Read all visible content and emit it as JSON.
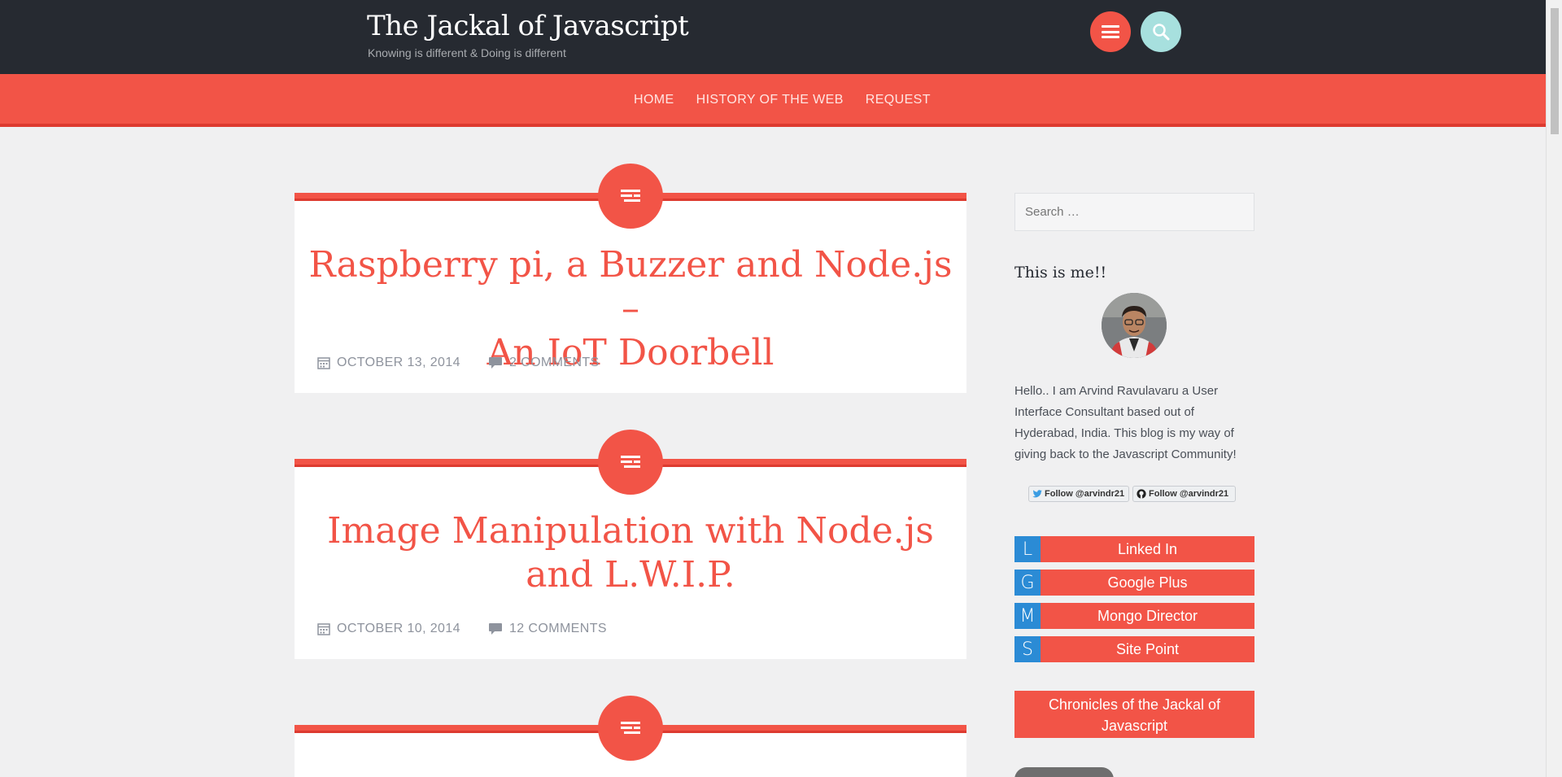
{
  "site": {
    "title": "The Jackal of Javascript",
    "description": "Knowing is different & Doing is different"
  },
  "nav": {
    "items": [
      "HOME",
      "HISTORY OF THE WEB",
      "REQUEST"
    ]
  },
  "posts": [
    {
      "title_line1": "Raspberry pi, a Buzzer and Node.js –",
      "title_line2": "An IoT Doorbell",
      "date": "OCTOBER 13, 2014",
      "comments": "2 COMMENTS"
    },
    {
      "title_line1": "Image Manipulation with Node.js",
      "title_line2": "and L.W.I.P.",
      "date": "OCTOBER 10, 2014",
      "comments": "12 COMMENTS"
    }
  ],
  "sidebar": {
    "search_placeholder": "Search …",
    "about_title": "This is me!!",
    "bio": "Hello.. I am Arvind Ravulavaru a User Interface Consultant based out of Hyderabad, India. This blog is my way of giving back to the Javascript Community!",
    "twitter_follow": "Follow @arvindr21",
    "github_follow": "Follow @arvindr21",
    "links": [
      {
        "letter": "L",
        "label": "Linked In"
      },
      {
        "letter": "G",
        "label": "Google Plus"
      },
      {
        "letter": "M",
        "label": "Mongo Director"
      },
      {
        "letter": "S",
        "label": "Site Point"
      }
    ],
    "chronicles_line1": "Chronicles of the Jackal of",
    "chronicles_line2": "Javascript"
  },
  "icons": {
    "menu": "hamburger-icon",
    "search": "search-icon",
    "post_format": "text-format-icon",
    "calendar": "calendar-icon",
    "comment": "comment-icon",
    "twitter": "twitter-icon",
    "github": "github-icon"
  },
  "colors": {
    "accent": "#f25447",
    "header_bg": "#262a31",
    "search_btn": "#a7e0de",
    "link_letter_bg": "#2b8bd5",
    "page_bg": "#f0f0f1"
  }
}
